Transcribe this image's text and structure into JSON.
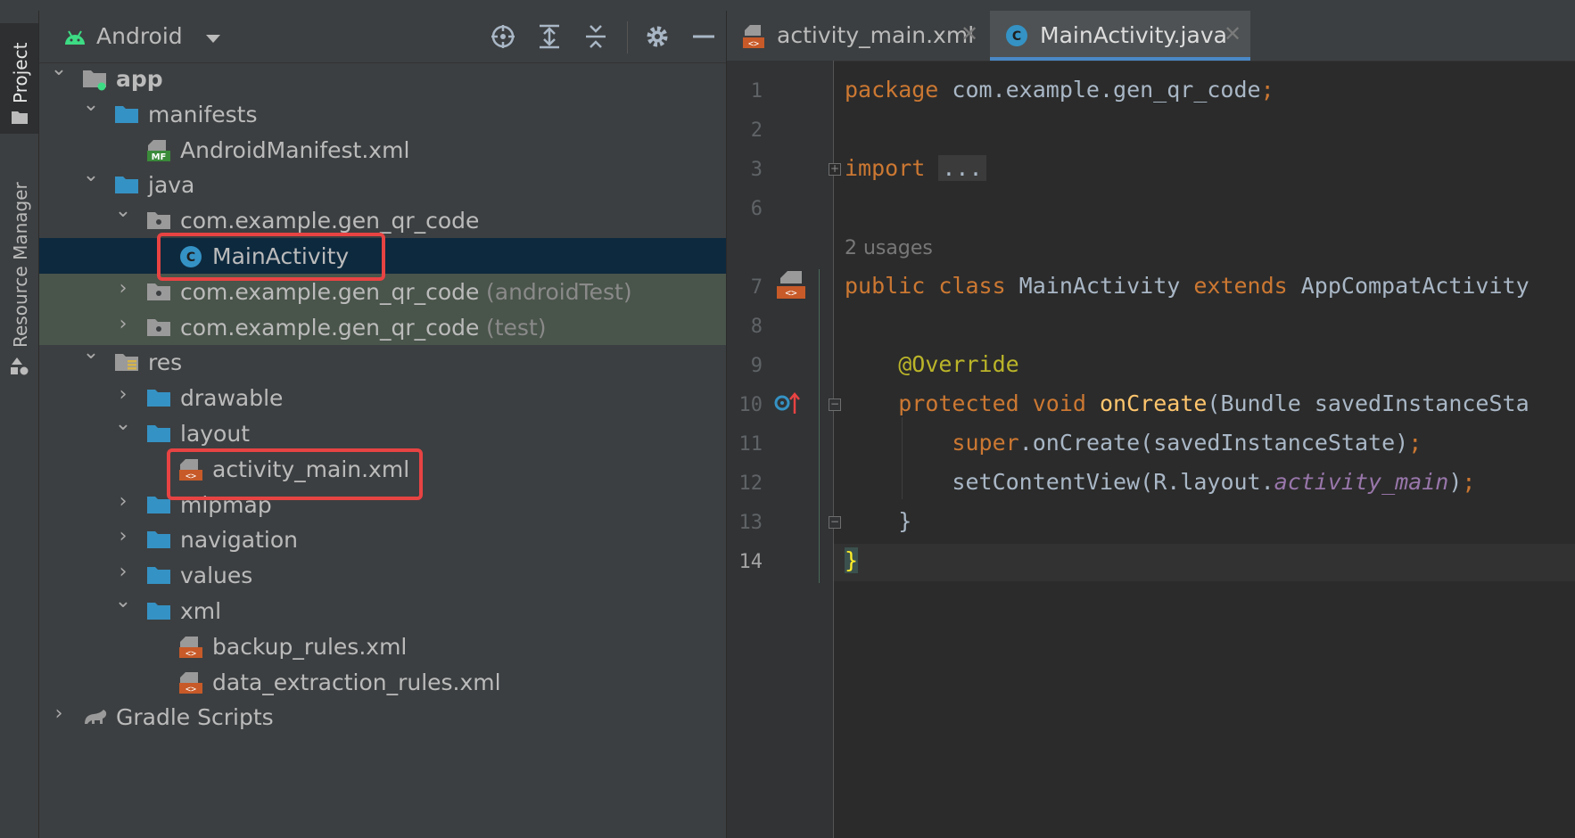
{
  "left_stripe": {
    "project_tab": "Project",
    "resource_manager_tab": "Resource Manager"
  },
  "project_panel": {
    "view_selector": "Android",
    "tree": [
      {
        "label": "app",
        "icon": "app-module-icon"
      },
      {
        "label": "manifests",
        "icon": "folder-icon"
      },
      {
        "label": "AndroidManifest.xml",
        "icon": "manifest-file-icon"
      },
      {
        "label": "java",
        "icon": "folder-icon"
      },
      {
        "label": "com.example.gen_qr_code",
        "icon": "package-icon"
      },
      {
        "label": "MainActivity",
        "icon": "java-class-icon"
      },
      {
        "label": "com.example.gen_qr_code",
        "suffix": "(androidTest)",
        "icon": "package-icon"
      },
      {
        "label": "com.example.gen_qr_code",
        "suffix": "(test)",
        "icon": "package-icon"
      },
      {
        "label": "res",
        "icon": "res-folder-icon"
      },
      {
        "label": "drawable",
        "icon": "folder-icon"
      },
      {
        "label": "layout",
        "icon": "folder-icon"
      },
      {
        "label": "activity_main.xml",
        "icon": "layout-file-icon"
      },
      {
        "label": "mipmap",
        "icon": "folder-icon"
      },
      {
        "label": "navigation",
        "icon": "folder-icon"
      },
      {
        "label": "values",
        "icon": "folder-icon"
      },
      {
        "label": "xml",
        "icon": "folder-icon"
      },
      {
        "label": "backup_rules.xml",
        "icon": "xml-file-icon"
      },
      {
        "label": "data_extraction_rules.xml",
        "icon": "xml-file-icon"
      },
      {
        "label": "Gradle Scripts",
        "icon": "gradle-icon"
      }
    ]
  },
  "editor": {
    "tabs": [
      {
        "label": "activity_main.xml",
        "active": false
      },
      {
        "label": "MainActivity.java",
        "active": true
      }
    ],
    "line_numbers": [
      "1",
      "2",
      "3",
      "6",
      "7",
      "8",
      "9",
      "10",
      "11",
      "12",
      "13",
      "14"
    ],
    "usages_hint": "2 usages",
    "code": {
      "l1_kw": "package",
      "l1_rest": " com.example.gen_qr_code",
      "l1_semi": ";",
      "l3_kw": "import",
      "l3_folded": "...",
      "l7_kw1": "public class",
      "l7_name": " MainActivity ",
      "l7_kw2": "extends",
      "l7_rest": " AppCompatActivity",
      "l9_ann": "@Override",
      "l10_kw": "protected void",
      "l10_fn": " onCreate",
      "l10_rest": "(Bundle savedInstanceSta",
      "l11_kw": "super",
      "l11_rest": ".onCreate(savedInstanceState)",
      "l11_semi": ";",
      "l12_pre": "setContentView(R.layout.",
      "l12_field": "activity_main",
      "l12_post": ")",
      "l12_semi": ";",
      "l13": "}",
      "l14": "}"
    }
  },
  "colors": {
    "highlight_box": "#e84343",
    "keyword": "#cc7832",
    "annotation": "#bbb529",
    "function": "#ffc66d",
    "selection": "#0d293e"
  }
}
